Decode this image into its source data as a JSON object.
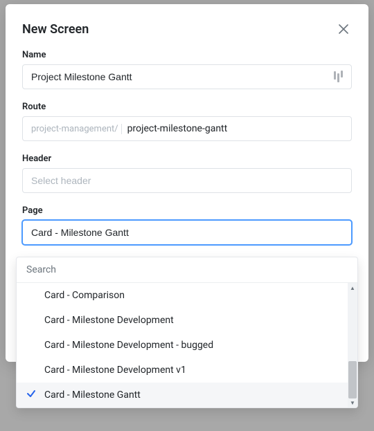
{
  "modal": {
    "title": "New Screen"
  },
  "fields": {
    "name": {
      "label": "Name",
      "value": "Project Milestone Gantt"
    },
    "route": {
      "label": "Route",
      "prefix": "project-management/",
      "value": "project-milestone-gantt"
    },
    "header": {
      "label": "Header",
      "placeholder": "Select header"
    },
    "page": {
      "label": "Page",
      "value": "Card - Milestone Gantt"
    }
  },
  "dropdown": {
    "search_placeholder": "Search",
    "options": [
      "Card - Comparison",
      "Card - Milestone Development",
      "Card - Milestone Development - bugged",
      "Card - Milestone Development v1",
      "Card - Milestone Gantt"
    ],
    "selected_index": 4
  }
}
